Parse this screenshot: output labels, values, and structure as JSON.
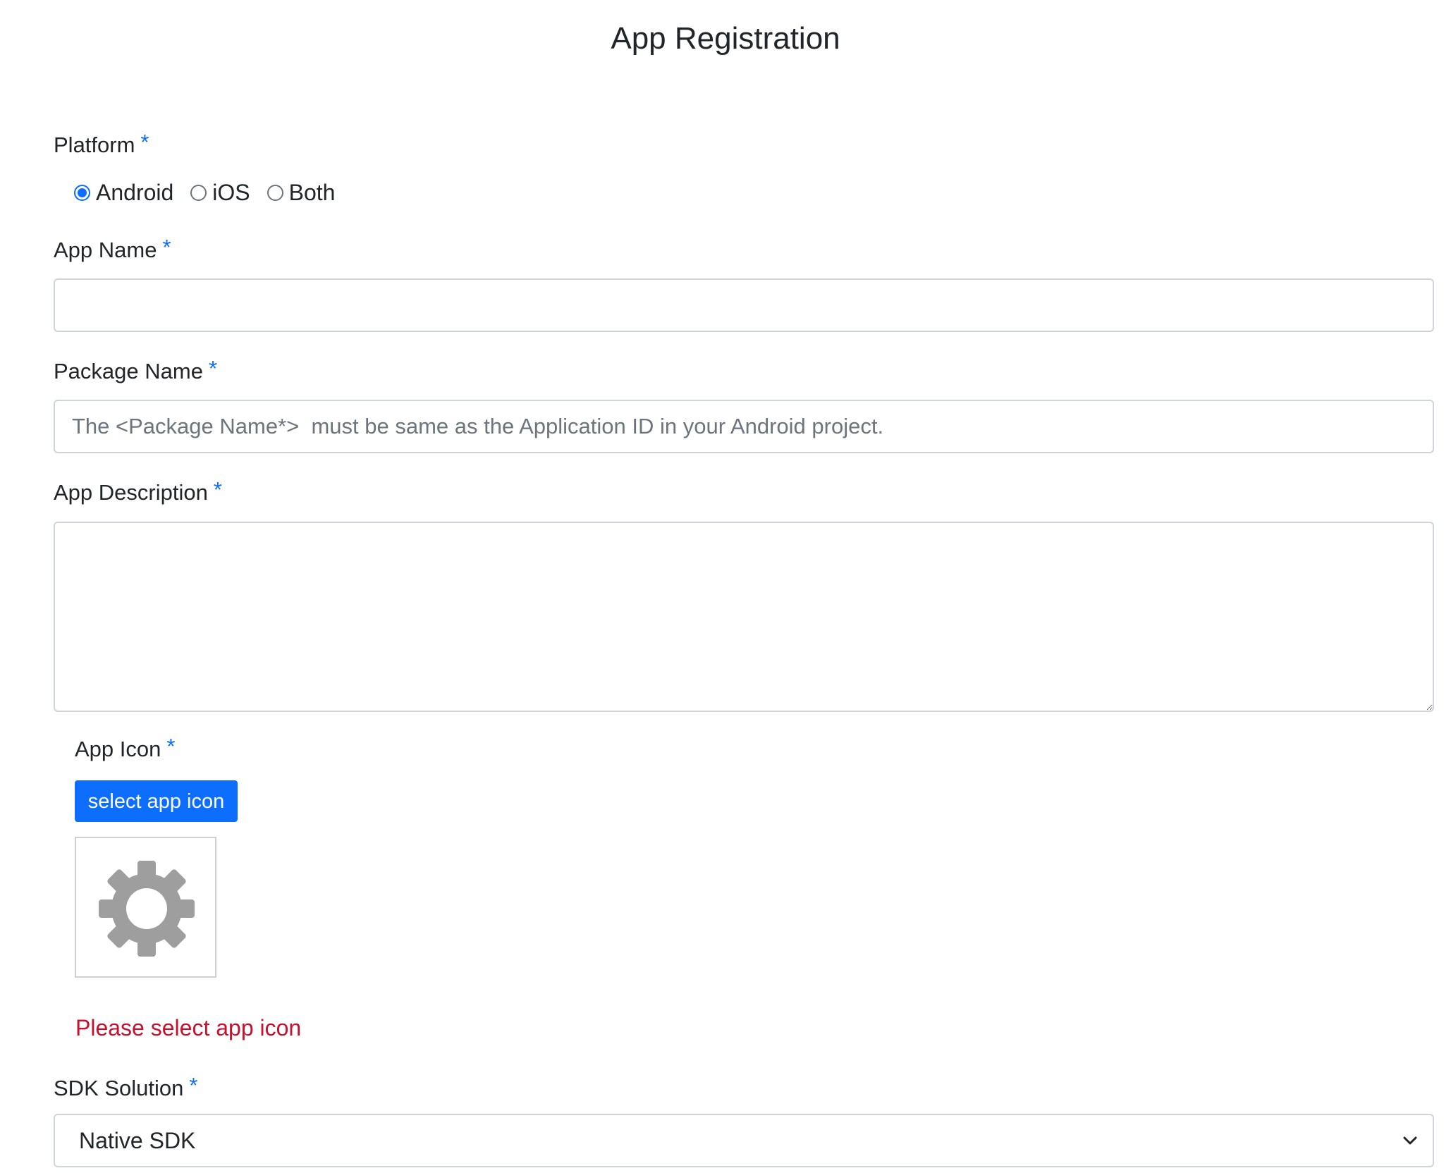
{
  "page": {
    "title": "App Registration"
  },
  "form": {
    "platform": {
      "label": "Platform",
      "required_mark": "*",
      "options": [
        {
          "label": "Android",
          "checked": true
        },
        {
          "label": "iOS",
          "checked": false
        },
        {
          "label": "Both",
          "checked": false
        }
      ]
    },
    "app_name": {
      "label": "App Name",
      "required_mark": "*",
      "value": "",
      "placeholder": ""
    },
    "package_name": {
      "label": "Package Name",
      "required_mark": "*",
      "value": "",
      "placeholder": "The <Package Name*>  must be same as the Application ID in your Android project."
    },
    "app_description": {
      "label": "App Description",
      "required_mark": "*",
      "value": "",
      "placeholder": ""
    },
    "app_icon": {
      "label": "App Icon",
      "required_mark": "*",
      "button_label": "select app icon",
      "preview_icon": "gear-icon",
      "error": "Please select app icon"
    },
    "sdk_solution": {
      "label": "SDK Solution",
      "required_mark": "*",
      "selected": "Native SDK"
    }
  },
  "colors": {
    "accent": "#0d6efd",
    "error": "#c8102e",
    "border": "#ced4da",
    "icon_gray": "#9e9e9e"
  }
}
